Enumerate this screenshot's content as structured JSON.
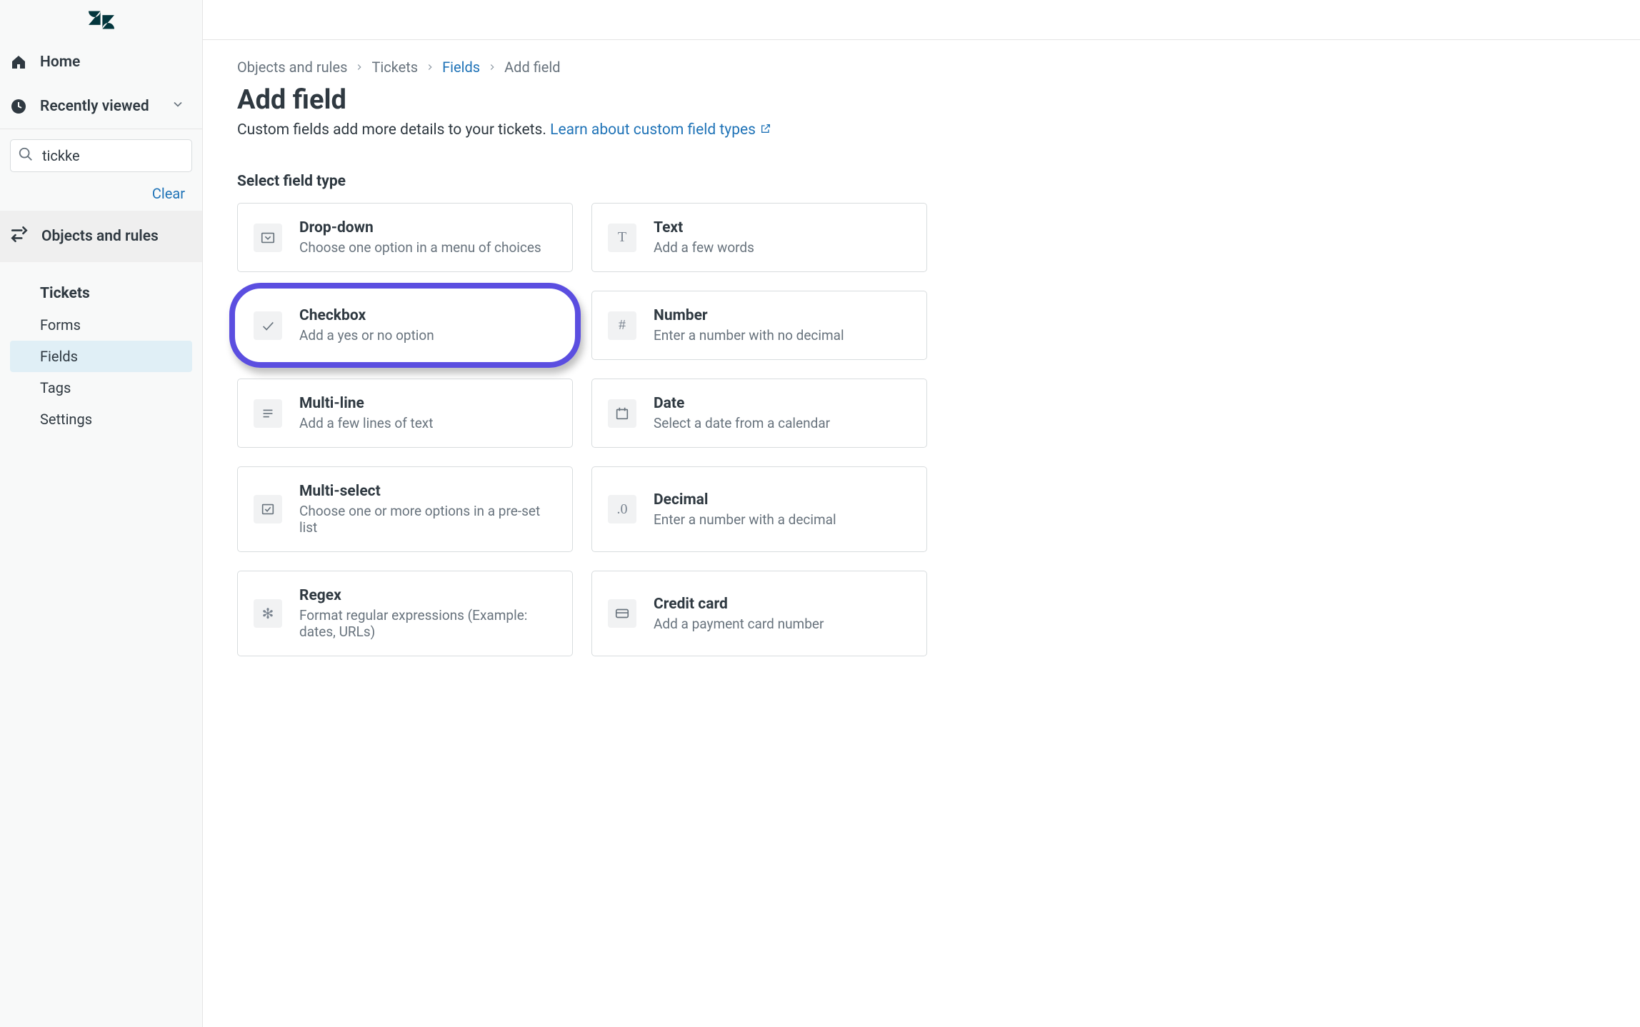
{
  "sidebar": {
    "home_label": "Home",
    "recent_label": "Recently viewed",
    "search_value": "tickke",
    "clear_label": "Clear",
    "section_label": "Objects and rules",
    "group_heading": "Tickets",
    "items": {
      "forms": {
        "label": "Forms"
      },
      "fields": {
        "label": "Fields"
      },
      "tags": {
        "label": "Tags"
      },
      "settings": {
        "label": "Settings"
      }
    }
  },
  "breadcrumbs": {
    "a": "Objects and rules",
    "b": "Tickets",
    "c": "Fields",
    "d": "Add field"
  },
  "header": {
    "title": "Add field",
    "subtitle_pre": "Custom fields add more details to your tickets. ",
    "learn_link": "Learn about custom field types"
  },
  "section_label": "Select field type",
  "field_types": {
    "dropdown": {
      "title": "Drop-down",
      "desc": "Choose one option in a menu of choices"
    },
    "text": {
      "title": "Text",
      "desc": "Add a few words"
    },
    "checkbox": {
      "title": "Checkbox",
      "desc": "Add a yes or no option"
    },
    "number": {
      "title": "Number",
      "desc": "Enter a number with no decimal"
    },
    "multiline": {
      "title": "Multi-line",
      "desc": "Add a few lines of text"
    },
    "date": {
      "title": "Date",
      "desc": "Select a date from a calendar"
    },
    "multiselect": {
      "title": "Multi-select",
      "desc": "Choose one or more options in a pre-set list"
    },
    "decimal": {
      "title": "Decimal",
      "desc": "Enter a number with a decimal"
    },
    "regex": {
      "title": "Regex",
      "desc": "Format regular expressions (Example: dates, URLs)"
    },
    "creditcard": {
      "title": "Credit card",
      "desc": "Add a payment card number"
    }
  },
  "highlighted_field_type": "checkbox"
}
